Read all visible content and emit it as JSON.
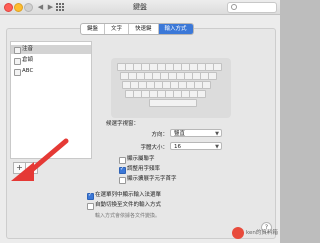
{
  "window": {
    "title": "鍵盤"
  },
  "tabs": [
    {
      "label": "鍵盤",
      "active": false
    },
    {
      "label": "文字",
      "active": false
    },
    {
      "label": "快速鍵",
      "active": false
    },
    {
      "label": "輸入方式",
      "active": true
    }
  ],
  "sidebar": {
    "items": [
      {
        "label": "注音",
        "selected": true
      },
      {
        "label": "倉頡",
        "selected": false
      },
      {
        "label": "ABC",
        "selected": false
      }
    ]
  },
  "buttons": {
    "add_label": "+",
    "remove_label": "−"
  },
  "settings": {
    "candidate_section_label": "候選字視窗：",
    "direction_label": "方向：",
    "direction_value": "豎直",
    "font_size_label": "字體大小：",
    "font_size_value": "16",
    "check_show_radicals": {
      "label": "顯示屬聯字",
      "checked": false
    },
    "check_adjust_frequency": {
      "label": "調整用字頻率",
      "checked": true
    },
    "check_show_extra": {
      "label": "顯示擴展字元字首字",
      "checked": false
    }
  },
  "bottom": {
    "show_in_menu": {
      "label": "在選單列中顯示輸入法選單",
      "checked": true
    },
    "auto_switch": {
      "label": "自動切換至文件的輸入方式",
      "checked": false
    },
    "auto_switch_note": "輸入方式會依據各文件變換。"
  },
  "help": "?",
  "watermark": {
    "text": "ken的資料箱"
  },
  "colors": {
    "accent": "#3b78d8",
    "arrow": "#e53935"
  }
}
